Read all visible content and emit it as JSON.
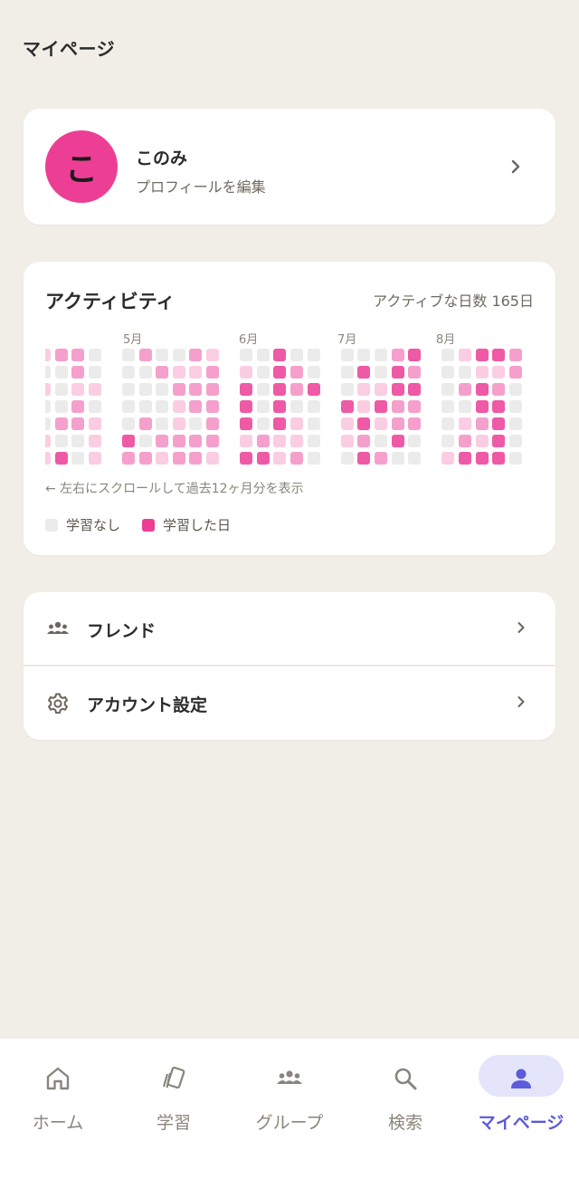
{
  "header": {
    "title": "マイページ"
  },
  "profile": {
    "avatar_initial": "こ",
    "name": "このみ",
    "edit_label": "プロフィールを編集"
  },
  "activity": {
    "title": "アクティビティ",
    "active_days_label": "アクティブな日数 165日",
    "months": [
      "5月",
      "6月",
      "7月",
      "8月"
    ],
    "colors": {
      "none": "#ebebeb",
      "light": "#fbcde3",
      "mid": "#f5a0cc",
      "strong": "#ee5aa5"
    },
    "weeks": [
      [
        1,
        0,
        1,
        0,
        0,
        1,
        1
      ],
      [
        2,
        0,
        0,
        0,
        2,
        0,
        3
      ],
      [
        2,
        2,
        1,
        2,
        2,
        0,
        0
      ],
      [
        0,
        0,
        1,
        0,
        1,
        1,
        1
      ],
      [],
      [
        0,
        0,
        0,
        0,
        0,
        3,
        2
      ],
      [
        2,
        0,
        0,
        0,
        2,
        0,
        2
      ],
      [
        0,
        2,
        0,
        0,
        0,
        2,
        1
      ],
      [
        0,
        1,
        2,
        1,
        1,
        2,
        2
      ],
      [
        2,
        1,
        2,
        2,
        0,
        2,
        2
      ],
      [
        1,
        2,
        2,
        2,
        2,
        2,
        1
      ],
      [],
      [
        0,
        1,
        3,
        3,
        3,
        1,
        3
      ],
      [
        0,
        0,
        0,
        0,
        0,
        2,
        3
      ],
      [
        3,
        3,
        3,
        3,
        3,
        1,
        1
      ],
      [
        0,
        2,
        2,
        0,
        1,
        1,
        2
      ],
      [
        0,
        0,
        3,
        0,
        0,
        0,
        0
      ],
      [],
      [
        0,
        0,
        0,
        3,
        1,
        1,
        0
      ],
      [
        0,
        3,
        1,
        1,
        3,
        2,
        3
      ],
      [
        0,
        0,
        1,
        3,
        1,
        0,
        2
      ],
      [
        2,
        3,
        3,
        2,
        2,
        3,
        0
      ],
      [
        3,
        2,
        3,
        2,
        2,
        0,
        0
      ],
      [],
      [
        0,
        0,
        0,
        0,
        0,
        0,
        1
      ],
      [
        1,
        0,
        2,
        0,
        1,
        2,
        3
      ],
      [
        3,
        1,
        3,
        3,
        2,
        1,
        3
      ],
      [
        3,
        1,
        2,
        3,
        3,
        3,
        3
      ],
      [
        2,
        2,
        0,
        0,
        0,
        0,
        0
      ]
    ],
    "scroll_hint": "← 左右にスクロールして過去12ヶ月分を表示",
    "legend": {
      "none_label": "学習なし",
      "studied_label": "学習した日"
    }
  },
  "menu": [
    {
      "label": "フレンド",
      "icon": "group-icon"
    },
    {
      "label": "アカウント設定",
      "icon": "gear-icon"
    }
  ],
  "nav": [
    {
      "label": "ホーム",
      "icon": "home-icon"
    },
    {
      "label": "学習",
      "icon": "cards-icon"
    },
    {
      "label": "グループ",
      "icon": "group-icon"
    },
    {
      "label": "検索",
      "icon": "search-icon"
    },
    {
      "label": "マイページ",
      "icon": "person-icon",
      "active": true
    }
  ],
  "accent": "#ec3e94",
  "nav_active_color": "#5b5bdc"
}
